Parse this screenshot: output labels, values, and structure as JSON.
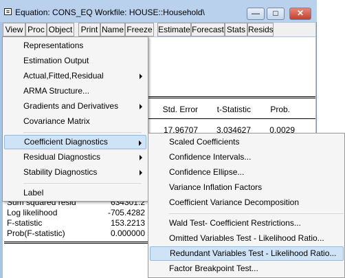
{
  "window": {
    "title": "Equation: CONS_EQ   Workfile: HOUSE::Household\\",
    "min_glyph": "—",
    "max_glyph": "□",
    "close_glyph": "✕"
  },
  "toolbar": {
    "buttons": [
      "View",
      "Proc",
      "Object",
      "Print",
      "Name",
      "Freeze",
      "Estimate",
      "Forecast",
      "Stats",
      "Resids"
    ]
  },
  "table": {
    "headers": {
      "std_error": "Std. Error",
      "t_statistic": "t-Statistic",
      "prob": "Prob."
    },
    "row1": {
      "std_error": "17.96707",
      "t_statistic": "3.034627",
      "prob": "0.0029"
    },
    "stats": [
      {
        "label": "Sum squared resid",
        "value": "634301.2"
      },
      {
        "label": "Log likelihood",
        "value": "-705.4282"
      },
      {
        "label": "F-statistic",
        "value": "153.2213"
      },
      {
        "label": "Prob(F-statistic)",
        "value": "0.000000"
      }
    ]
  },
  "view_menu": {
    "items": [
      {
        "label": "Representations",
        "submenu": false
      },
      {
        "label": "Estimation Output",
        "submenu": false
      },
      {
        "label": "Actual,Fitted,Residual",
        "submenu": true
      },
      {
        "label": "ARMA Structure...",
        "submenu": false
      },
      {
        "label": "Gradients and Derivatives",
        "submenu": true
      },
      {
        "label": "Covariance Matrix",
        "submenu": false
      },
      {
        "label": "Coefficient Diagnostics",
        "submenu": true,
        "selected": true
      },
      {
        "label": "Residual Diagnostics",
        "submenu": true
      },
      {
        "label": "Stability Diagnostics",
        "submenu": true
      },
      {
        "label": "Label",
        "submenu": false
      }
    ]
  },
  "coef_submenu": {
    "items": [
      {
        "label": "Scaled Coefficients"
      },
      {
        "label": "Confidence Intervals..."
      },
      {
        "label": "Confidence Ellipse..."
      },
      {
        "label": "Variance Inflation Factors"
      },
      {
        "label": "Coefficient Variance Decomposition"
      },
      {
        "label": "Wald Test- Coefficient Restrictions..."
      },
      {
        "label": "Omitted Variables Test - Likelihood Ratio..."
      },
      {
        "label": "Redundant Variables Test - Likelihood Ratio...",
        "selected": true
      },
      {
        "label": "Factor Breakpoint Test..."
      }
    ]
  },
  "colors": {
    "title_bar": "#b9d1ec",
    "menu_highlight": "#cfe3f7",
    "close_button": "#c3402c"
  }
}
